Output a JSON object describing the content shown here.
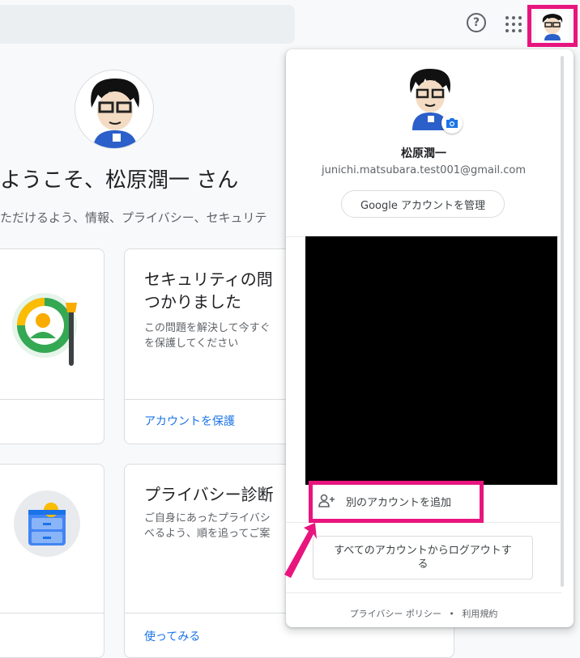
{
  "header": {
    "help_icon": "help-icon",
    "apps_icon": "apps-grid-icon",
    "help_glyph": "?"
  },
  "main": {
    "welcome": "ようこそ、松原潤一 さん",
    "subtitle": "ただけるよう、情報、プライバシー、セキュリテ",
    "cards": [
      {
        "title_line1": "セキュリティの問",
        "title_line2": "つかりました",
        "desc_line1": "この問題を解決して今すぐ",
        "desc_line2": "を保護してください",
        "link": "アカウントを保護"
      },
      {
        "title_line1": "プライバシー診断",
        "desc_line1": "ご自身にあったプライバシ",
        "desc_line2": "べるよう、順を追ってご案",
        "link": "使ってみる"
      }
    ]
  },
  "popup": {
    "name": "松原潤一",
    "email": "junichi.matsubara.test001@gmail.com",
    "manage_label": "Google アカウントを管理",
    "add_account_label": "別のアカウントを追加",
    "logout_label": "すべてのアカウントからログアウトする",
    "privacy": "プライバシー ポリシー",
    "separator": "•",
    "terms": "利用規約"
  },
  "colors": {
    "highlight": "#e8157f",
    "link": "#1a73e8"
  }
}
